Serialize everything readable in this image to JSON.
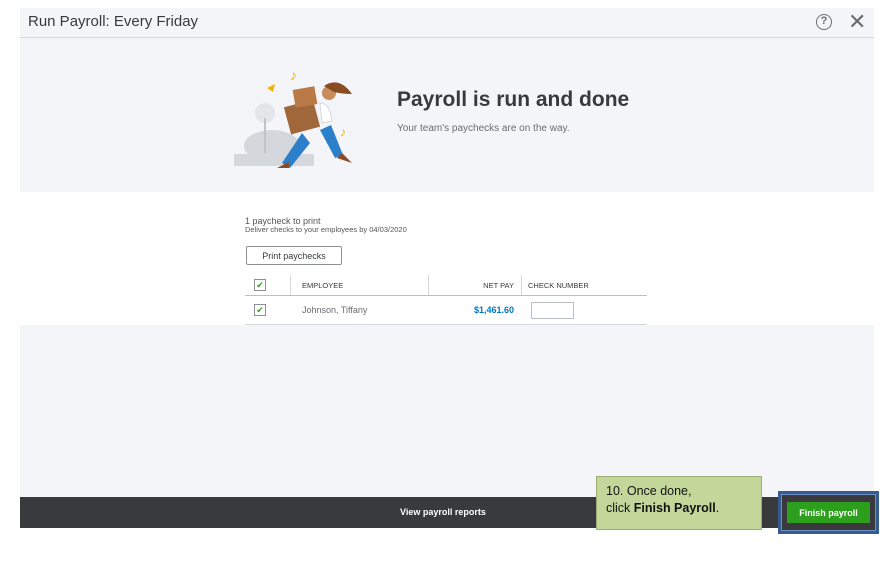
{
  "window": {
    "title": "Run Payroll: Every Friday",
    "help_icon": "?",
    "close_icon": "✕"
  },
  "hero": {
    "heading": "Payroll is run and done",
    "subtext": "Your team's paychecks are on the way."
  },
  "print": {
    "count_text": "1 paycheck to print",
    "deliver_text": "Deliver checks to your employees by 04/03/2020",
    "button_label": "Print paychecks"
  },
  "table": {
    "headers": {
      "employee": "EMPLOYEE",
      "net_pay": "NET PAY",
      "check_number": "CHECK NUMBER"
    },
    "rows": [
      {
        "employee": "Johnson, Tiffany",
        "net_pay": "$1,461.60",
        "check_number": "",
        "checked": true
      }
    ]
  },
  "footer": {
    "reports_label": "View payroll reports",
    "finish_label": "Finish payroll"
  },
  "callout": {
    "line1": "10.  Once done,",
    "line2_prefix": "click ",
    "line2_bold": "Finish Payroll",
    "line2_suffix": "."
  }
}
